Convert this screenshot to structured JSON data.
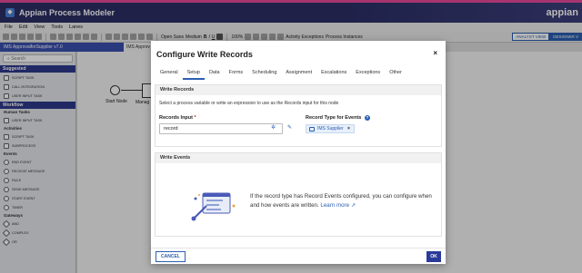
{
  "app": {
    "title": "Appian Process Modeler",
    "brand": "appian"
  },
  "menu": [
    "File",
    "Edit",
    "View",
    "Tools",
    "Lanes"
  ],
  "toolbar": {
    "font": "Open Sans",
    "weight": "Medium",
    "bold": "B",
    "italic": "I",
    "underline": "U",
    "zoom": "100%",
    "activity_exceptions": "Activity Exceptions",
    "process_instances": "Process Instances",
    "analyst_view": "ANALYST VIEW",
    "designer_view": "DESIGNER V"
  },
  "doc_tabs": [
    "IMS ApprovalforSupplier v7.0",
    "IMS Approv"
  ],
  "palette": {
    "search_placeholder": "Search",
    "sections": {
      "suggested": "Suggested",
      "workflow": "Workflow",
      "human_tasks": "Human Tasks",
      "activities": "Activities",
      "events": "Events",
      "gateways": "Gateways"
    },
    "suggested_items": [
      "SCRIPT TASK",
      "CALL INTEGRATION",
      "USER INPUT TASK"
    ],
    "human_task_items": [
      "USER INPUT TASK"
    ],
    "activity_items": [
      "SCRIPT TASK",
      "SUBPROCESS"
    ],
    "event_items": [
      "END EVENT",
      "RECEIVE MESSAGE",
      "RULE",
      "SEND MESSAGE",
      "START EVENT",
      "TIMER"
    ],
    "gateway_items": [
      "AND",
      "COMPLEX",
      "OR"
    ]
  },
  "canvas": {
    "start_node": "Start Node",
    "node2": "Manag"
  },
  "modal": {
    "title": "Configure Write Records",
    "close": "×",
    "tabs": [
      "General",
      "Setup",
      "Data",
      "Forms",
      "Scheduling",
      "Assignment",
      "Escalations",
      "Exceptions",
      "Other"
    ],
    "active_tab": "Setup",
    "write_records": {
      "header": "Write Records",
      "description": "Select a process variable or write an expression to use as the Records input for this node",
      "records_input_label": "Records Input",
      "required_mark": "*",
      "records_input_value": "record",
      "record_type_label": "Record Type for Events",
      "help": "?",
      "record_type_chip": "IMS Supplier",
      "chip_remove": "×"
    },
    "write_events": {
      "header": "Write Events",
      "text": "If the record type has Record Events configured, you can configure when and how events are written.",
      "link": "Learn more"
    },
    "cancel": "CANCEL",
    "ok": "OK"
  },
  "colors": {
    "accent": "#2b5fb0",
    "header_bg": "#2b2f66",
    "ok_button": "#2a3a9a",
    "gradient_stripe": "#e64a9a"
  }
}
